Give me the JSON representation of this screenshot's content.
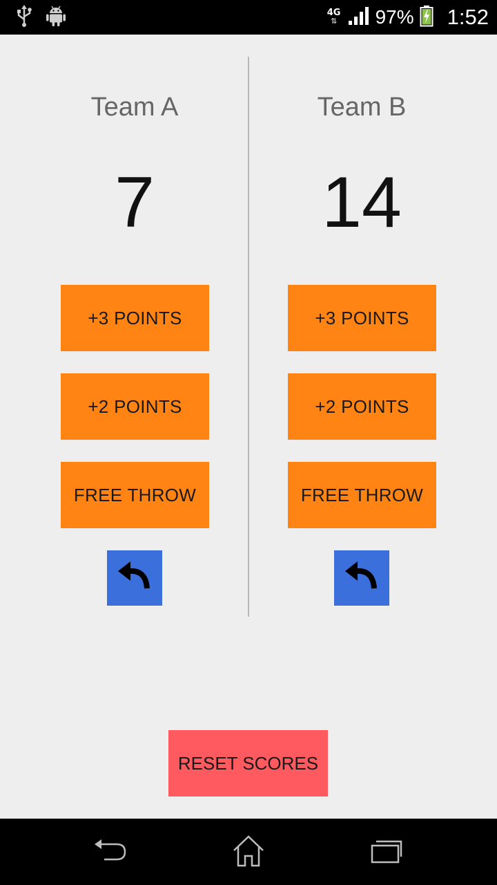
{
  "status_bar": {
    "network_type": "4G",
    "battery_percent": "97%",
    "time": "1:52",
    "icons": [
      "usb-icon",
      "android-debug-icon",
      "signal-icon",
      "battery-charging-icon"
    ]
  },
  "teams": [
    {
      "name": "Team A",
      "score": "7"
    },
    {
      "name": "Team B",
      "score": "14"
    }
  ],
  "buttons": {
    "plus3": "+3 POINTS",
    "plus2": "+2 POINTS",
    "free_throw": "FREE THROW",
    "reset": "RESET SCORES"
  },
  "colors": {
    "background": "#eeeeee",
    "point_button": "#ff8414",
    "undo_button": "#3b6fdc",
    "reset_button": "#ff5a5f",
    "divider": "#b8b8b8"
  },
  "nav_bar": {
    "icons": [
      "back-icon",
      "home-icon",
      "recent-apps-icon"
    ]
  }
}
